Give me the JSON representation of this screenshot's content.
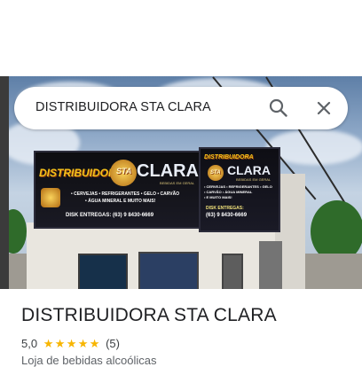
{
  "search": {
    "query": "DISTRIBUIDORA STA CLARA"
  },
  "icons": {
    "search": "magnifier-icon",
    "close": "close-x-icon",
    "star": "star-icon"
  },
  "photo": {
    "sign_brand_left": "DISTRIBUIDORA",
    "sign_brand_right": "CLARA",
    "sign_badge_text": "STA",
    "sign_tagline": "BEBIDAS EM GERAL",
    "sign_products_line1": "• CERVEJAS • REFRIGERANTES • GELO • CARVÃO",
    "sign_products_line2": "• ÁGUA MINERAL E MUITO MAIS!",
    "sign_phone": "DISK ENTREGAS: (63) 9 8430-6669",
    "side_brand_left": "DISTRIBUIDORA",
    "side_brand_right": "CLARA",
    "side_badge_text": "STA",
    "side_tagline": "BEBIDAS EM GERAL",
    "side_products_line1": "• CERVEJAS • REFRIGERANTES • GELO",
    "side_products_line2": "• CARVÃO • ÁGUA MINERAL",
    "side_products_line3": "• E MUITO MAIS!",
    "side_phone_label": "DISK ENTREGAS:",
    "side_phone": "(63) 9 8430-6669"
  },
  "place": {
    "name": "DISTRIBUIDORA STA CLARA",
    "rating": "5,0",
    "stars_filled": 5,
    "stars_glyph": "★",
    "review_count": "(5)",
    "category": "Loja de bebidas alcoólicas"
  },
  "colors": {
    "star": "#f7b500",
    "title": "#202124",
    "secondary_text": "#5f6368",
    "sign_yellow": "#f6c21a"
  }
}
